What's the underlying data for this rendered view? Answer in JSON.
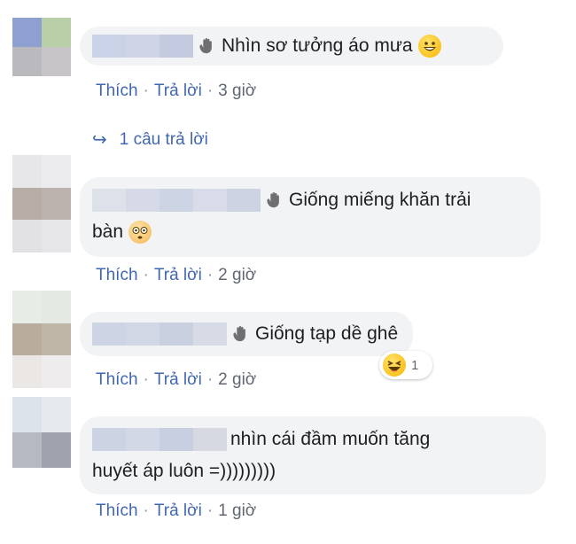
{
  "comments": [
    {
      "text": "Nhìn sơ tưởng áo mưa",
      "emoji": "grinning-face-emoji",
      "actions": {
        "like": "Thích",
        "reply": "Trả lời",
        "time": "3 giờ"
      },
      "reply_count": "1 câu trả lời"
    },
    {
      "text_line1": "Giống miếng khăn trải",
      "text_line2": "bàn",
      "emoji": "flushed-face-emoji",
      "actions": {
        "like": "Thích",
        "reply": "Trả lời",
        "time": "2 giờ"
      }
    },
    {
      "text": "Giống tạp dề ghê",
      "actions": {
        "like": "Thích",
        "reply": "Trả lời",
        "time": "2 giờ"
      },
      "reaction": {
        "icon": "laughing-face-emoji",
        "count": "1"
      }
    },
    {
      "text_line1": "nhìn cái đầm muốn tăng",
      "text_line2": "huyết áp luôn =)))))))))",
      "actions": {
        "like": "Thích",
        "reply": "Trả lời",
        "time": "1 giờ"
      }
    }
  ],
  "separator": "·",
  "colors": {
    "link": "#4267b2",
    "bubble": "#f2f3f5",
    "muted": "#606770"
  }
}
